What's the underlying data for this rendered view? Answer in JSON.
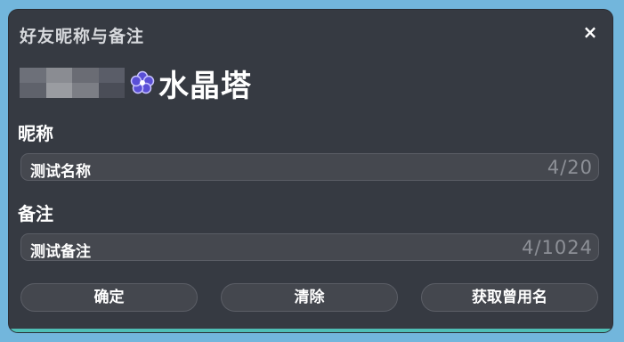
{
  "dialog": {
    "title": "好友昵称与备注",
    "close_label": "×"
  },
  "user": {
    "icon": "flower-icon",
    "name": "水晶塔"
  },
  "nickname": {
    "label": "昵称",
    "value": "测试名称",
    "counter": "4/20"
  },
  "remark": {
    "label": "备注",
    "value": "测试备注",
    "counter": "4/1024"
  },
  "buttons": {
    "confirm": "确定",
    "clear": "清除",
    "history": "获取曾用名"
  },
  "colors": {
    "accent_strip": "#4fbfb6",
    "background": "#72b6dc",
    "dialog": "#363a42"
  }
}
